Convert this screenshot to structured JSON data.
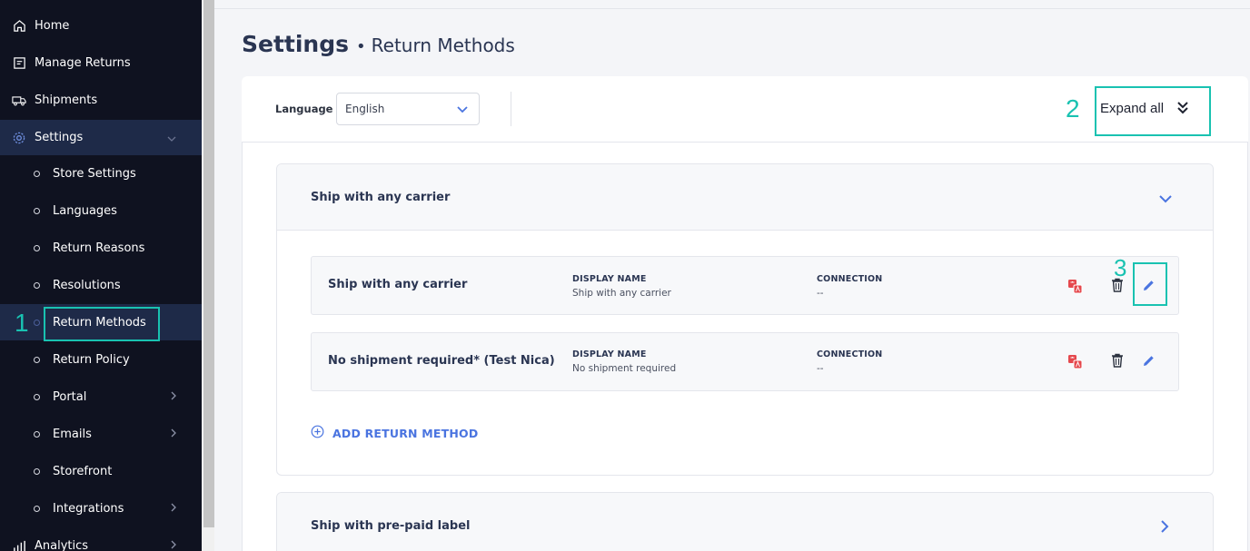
{
  "sidebar": {
    "top_items": [
      {
        "label": "Home",
        "icon": "home-icon"
      },
      {
        "label": "Manage Returns",
        "icon": "returns-icon"
      },
      {
        "label": "Shipments",
        "icon": "truck-icon"
      },
      {
        "label": "Settings",
        "icon": "gear-icon"
      }
    ],
    "settings_sub_items": [
      {
        "label": "Store Settings"
      },
      {
        "label": "Languages"
      },
      {
        "label": "Return Reasons"
      },
      {
        "label": "Resolutions"
      },
      {
        "label": "Return Methods"
      },
      {
        "label": "Return Policy"
      },
      {
        "label": "Portal"
      },
      {
        "label": "Emails"
      },
      {
        "label": "Storefront"
      },
      {
        "label": "Integrations"
      }
    ],
    "analytics": {
      "label": "Analytics",
      "icon": "chart-icon"
    }
  },
  "annotations": {
    "one": "1",
    "two": "2",
    "three": "3"
  },
  "page": {
    "title": "Settings",
    "separator": "•",
    "subtitle": "Return Methods"
  },
  "language": {
    "label": "Language",
    "selected": "English"
  },
  "expand_all": {
    "label": "Expand all"
  },
  "groups": [
    {
      "title": "Ship with any carrier",
      "methods": [
        {
          "name": "Ship with any carrier",
          "display_name_label": "DISPLAY NAME",
          "display_name": "Ship with any carrier",
          "connection_label": "CONNECTION",
          "connection": "--"
        },
        {
          "name": "No shipment required* (Test Nica)",
          "display_name_label": "DISPLAY NAME",
          "display_name": "No shipment required",
          "connection_label": "CONNECTION",
          "connection": "--"
        }
      ],
      "add_label": "ADD RETURN METHOD"
    },
    {
      "title": "Ship with pre-paid label"
    }
  ],
  "colors": {
    "sidebar_bg": "#0f1220",
    "sidebar_active": "#1e2a48",
    "annotation": "#19c2b1",
    "accent_blue": "#4a74e0",
    "translate_red": "#e5484d"
  }
}
